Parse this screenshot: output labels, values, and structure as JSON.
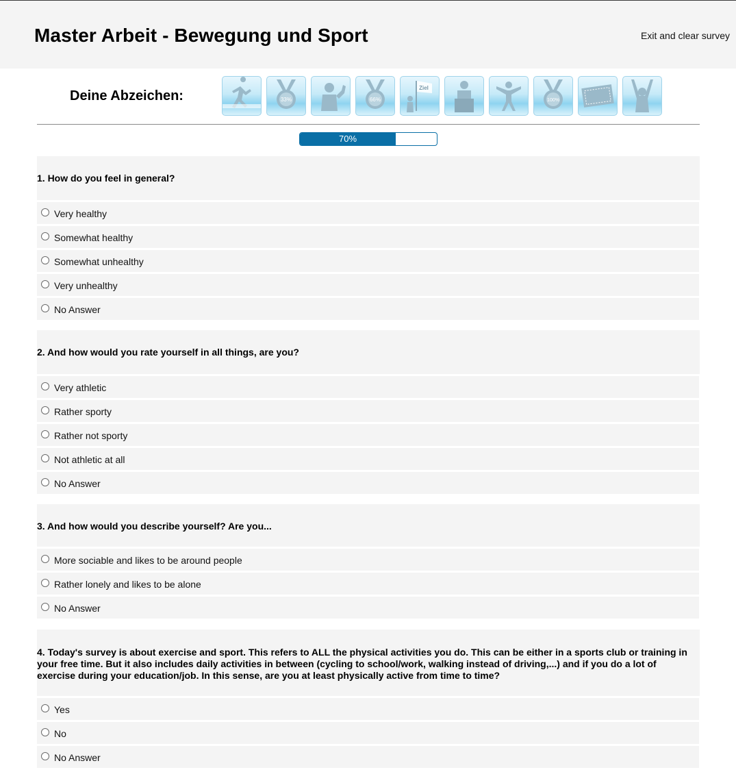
{
  "header": {
    "title": "Master Arbeit - Bewegung und Sport",
    "exit_label": "Exit and clear survey"
  },
  "badges": {
    "label": "Deine Abzeichen:",
    "items": [
      {
        "icon": "runner-badge-icon",
        "text": ""
      },
      {
        "icon": "medal-33-icon",
        "text": "33%"
      },
      {
        "icon": "thumbs-up-figure-badge-icon",
        "text": ""
      },
      {
        "icon": "medal-66-icon",
        "text": "66%"
      },
      {
        "icon": "goal-flag-badge-icon",
        "text": "Ziel"
      },
      {
        "icon": "podium-badge-icon",
        "text": ""
      },
      {
        "icon": "jumping-figure-badge-icon",
        "text": ""
      },
      {
        "icon": "medal-100-icon",
        "text": "100%"
      },
      {
        "icon": "ticket-badge-icon",
        "text": ""
      },
      {
        "icon": "cheering-figure-badge-icon",
        "text": ""
      }
    ]
  },
  "progress": {
    "value": 0.7,
    "label": "70%"
  },
  "colors": {
    "accent": "#0a6fa6",
    "panel": "#f4f4f4"
  },
  "questions": [
    {
      "text": "1. How do you feel in general?",
      "options": [
        "Very healthy",
        "Somewhat healthy",
        "Somewhat unhealthy",
        "Very unhealthy",
        "No Answer"
      ]
    },
    {
      "text": "2. And how would you rate yourself in all things, are you?",
      "options": [
        "Very athletic",
        "Rather sporty",
        "Rather not sporty",
        "Not athletic at all",
        "No Answer"
      ]
    },
    {
      "text": "3. And how would you describe yourself? Are you...",
      "options": [
        "More sociable and likes to be around people",
        "Rather lonely and likes to be alone",
        "No Answer"
      ]
    },
    {
      "text": "4. Today's survey is about exercise and sport. This refers to ALL the physical activities you do. This can be either in a sports club or training in your free time. But it also includes daily activities in between (cycling to school/work, walking instead of driving,...) and if you do a lot of exercise during your education/job. In this sense, are you at least physically active from time to time?",
      "options": [
        "Yes",
        "No",
        "No Answer"
      ]
    }
  ]
}
